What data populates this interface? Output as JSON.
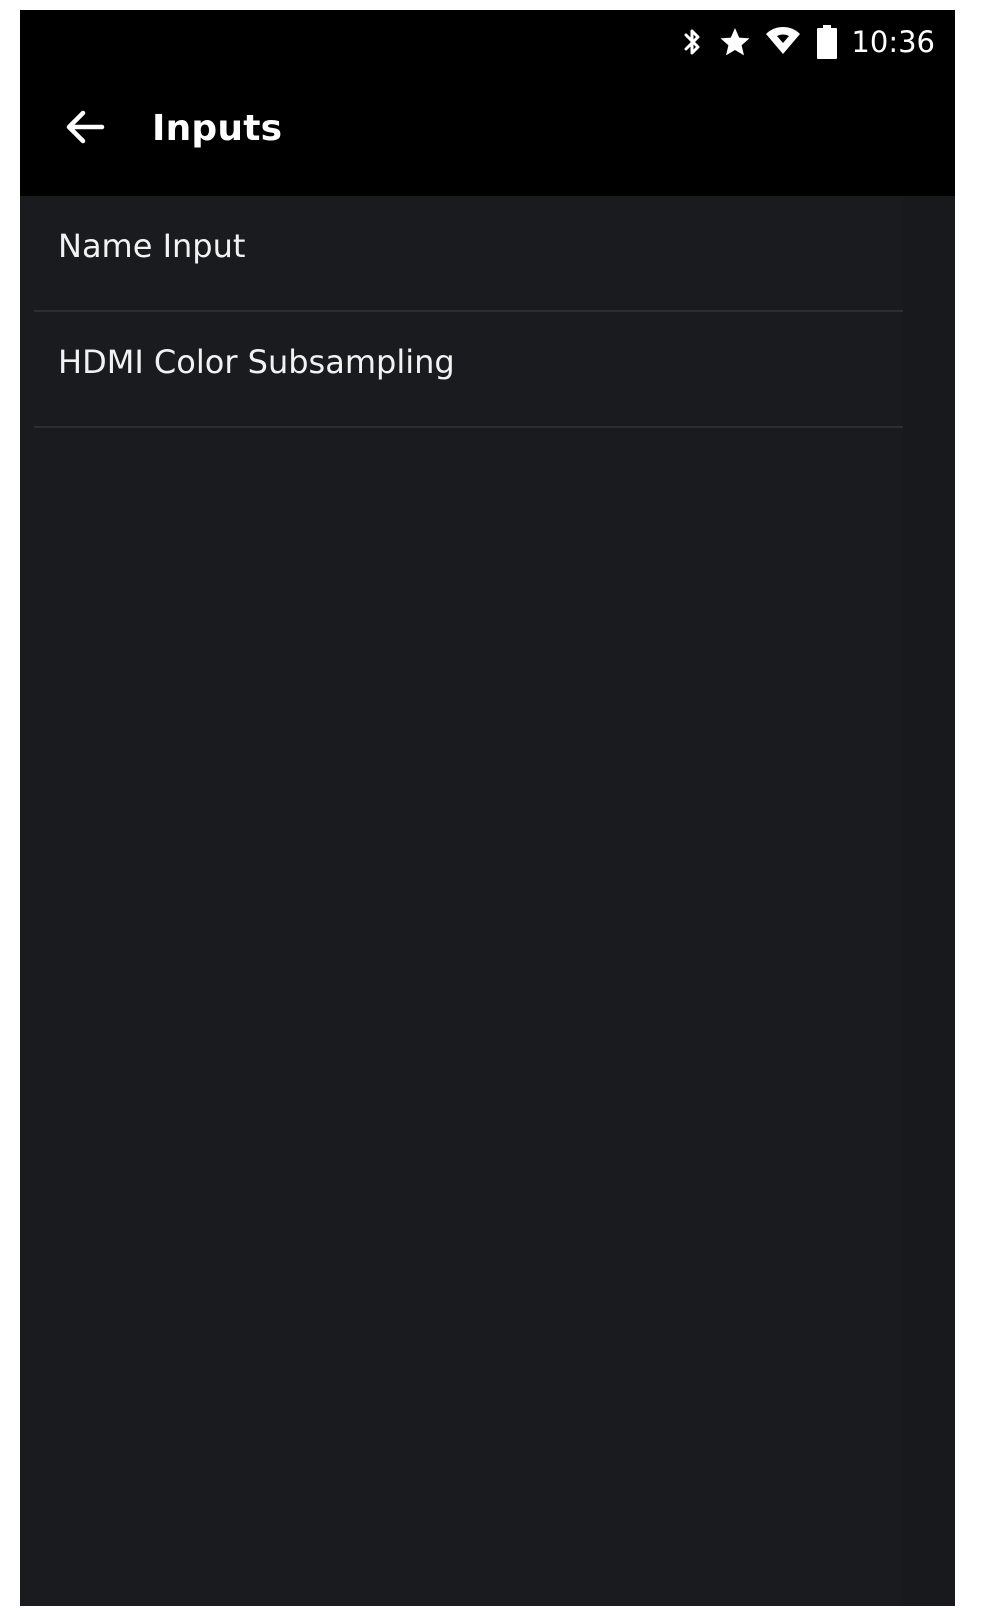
{
  "status_bar": {
    "icons": [
      "bluetooth-icon",
      "star-icon",
      "wifi-icon",
      "battery-icon"
    ],
    "time": "10:36"
  },
  "app_bar": {
    "back_icon": "arrow-left-icon",
    "title": "Inputs"
  },
  "menu": {
    "items": [
      {
        "label": "Name Input"
      },
      {
        "label": "HDMI Color Subsampling"
      }
    ]
  },
  "colors": {
    "background": "#1a1b1e",
    "bars": "#000000",
    "text": "#f2f2f2",
    "divider": "#2c2d31"
  }
}
